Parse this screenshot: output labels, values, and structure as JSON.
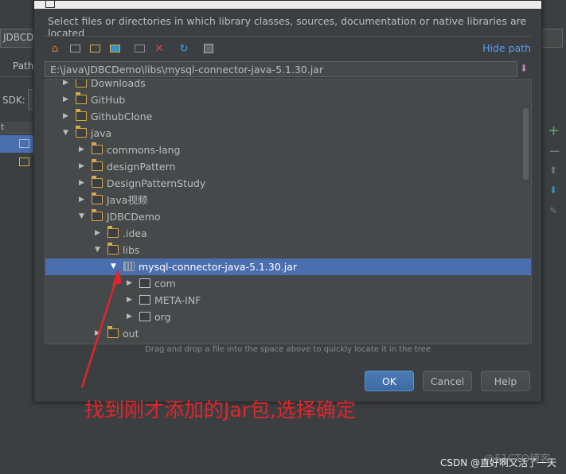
{
  "background": {
    "module_field": "JDBCD",
    "tab_label": "Path",
    "sdk_label": "SDK:",
    "column_label": "t"
  },
  "dialog": {
    "description": "Select files or directories in which library classes, sources, documentation or native libraries are located",
    "hide_path_label": "Hide path",
    "path_value": "E:\\java\\JDBCDemo\\libs\\mysql-connector-java-5.1.30.jar",
    "toolbar_icons": [
      "home-icon",
      "desktop-icon",
      "project-folder-icon",
      "module-folder-icon",
      "new-folder-icon",
      "delete-icon",
      "refresh-icon",
      "show-hidden-icon"
    ],
    "tree": [
      {
        "label": "Downloads",
        "type": "folder",
        "expanded": false
      },
      {
        "label": "GitHub",
        "type": "folder",
        "expanded": false
      },
      {
        "label": "GithubClone",
        "type": "folder",
        "expanded": false
      },
      {
        "label": "java",
        "type": "folder",
        "expanded": true
      },
      {
        "label": "commons-lang",
        "type": "folder",
        "expanded": false
      },
      {
        "label": "designPattern",
        "type": "folder",
        "expanded": false
      },
      {
        "label": "DesignPatternStudy",
        "type": "folder",
        "expanded": false
      },
      {
        "label": "Java视频",
        "type": "folder",
        "expanded": false
      },
      {
        "label": "JDBCDemo",
        "type": "folder",
        "expanded": true
      },
      {
        "label": ".idea",
        "type": "folder",
        "expanded": false
      },
      {
        "label": "libs",
        "type": "folder",
        "expanded": true
      },
      {
        "label": "mysql-connector-java-5.1.30.jar",
        "type": "jar",
        "expanded": true,
        "selected": true
      },
      {
        "label": "com",
        "type": "package",
        "expanded": false
      },
      {
        "label": "META-INF",
        "type": "package",
        "expanded": false
      },
      {
        "label": "org",
        "type": "package",
        "expanded": false
      },
      {
        "label": "out",
        "type": "folder",
        "expanded": false
      }
    ],
    "hint": "Drag and drop a file into the space above to quickly locate it in the tree",
    "ok_label": "OK",
    "cancel_label": "Cancel",
    "help_label": "Help"
  },
  "annotation": {
    "text": "找到刚才添加的Jar包,选择确定",
    "color": "#e0262c"
  },
  "watermark": {
    "text": "CSDN @直好啊又活了一天",
    "faint_text": "@51CTO博客"
  }
}
